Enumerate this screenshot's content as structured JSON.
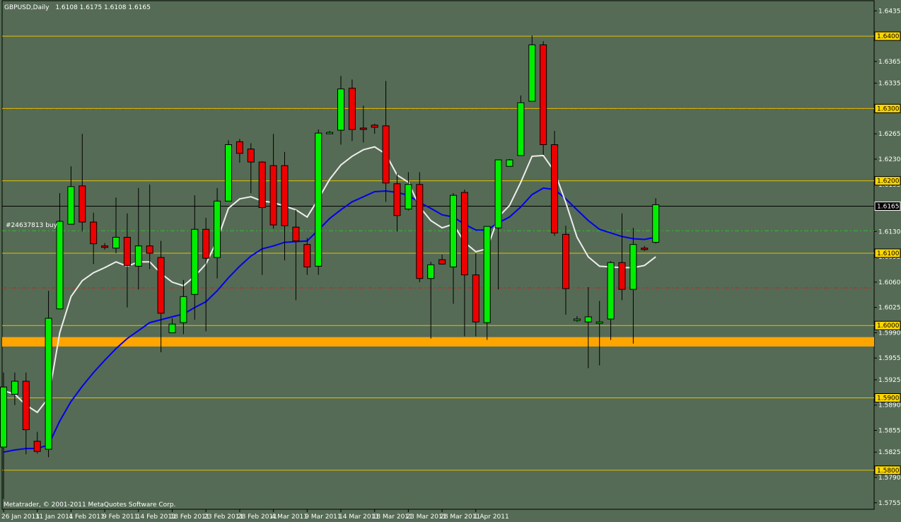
{
  "header": {
    "symbol": "GBPUSD,Daily",
    "ohlc": "1.6108 1.6175 1.6108 1.6165"
  },
  "order_label": "#24637813 buy",
  "copyright": "Metatrader, © 2001-2011 MetaQuotes Software Corp.",
  "current_price": "1.6165",
  "colors": {
    "background": "#556B55",
    "bull": "#00EE00",
    "bear": "#EE0000",
    "ma_fast": "#EEEEEE",
    "ma_slow": "#0000EE",
    "level_line": "#E0C000",
    "zone": "#FFA500",
    "red_dash": "#CC2020",
    "green_dash": "#33BB33"
  },
  "chart_data": {
    "type": "candlestick",
    "ylim": [
      1.5746,
      1.6449
    ],
    "y_ticks": [
      "1.6435",
      "1.6400",
      "1.6365",
      "1.6335",
      "1.6300",
      "1.6265",
      "1.6230",
      "1.6195",
      "1.6165",
      "1.6130",
      "1.6100",
      "1.6095",
      "1.6060",
      "1.6025",
      "1.6000",
      "1.5990",
      "1.5955",
      "1.5925",
      "1.5900",
      "1.5890",
      "1.5855",
      "1.5825",
      "1.5800",
      "1.5790",
      "1.5755"
    ],
    "x_labels": [
      "26 Jan 2011",
      "31 Jan 2011",
      "4 Feb 2011",
      "9 Feb 2011",
      "14 Feb 2011",
      "18 Feb 2011",
      "23 Feb 2011",
      "28 Feb 2011",
      "4 Mar 2011",
      "9 Mar 2011",
      "14 Mar 2011",
      "18 Mar 2011",
      "23 Mar 2011",
      "28 Mar 2011",
      "1 Apr 2011"
    ],
    "horizontal_levels": [
      {
        "price": 1.64,
        "label": "1.6400"
      },
      {
        "price": 1.63,
        "label": "1.6300"
      },
      {
        "price": 1.62,
        "label": "1.6200"
      },
      {
        "price": 1.61,
        "label": "1.6100"
      },
      {
        "price": 1.6,
        "label": "1.6000"
      },
      {
        "price": 1.59,
        "label": "1.5900"
      },
      {
        "price": 1.58,
        "label": "1.5800"
      }
    ],
    "zone": {
      "from": 1.5971,
      "to": 1.5984
    },
    "red_dashed_levels": [
      1.6299,
      1.6052
    ],
    "green_dashed_level": 1.6131,
    "candles": [
      {
        "o": 1.5832,
        "h": 1.5935,
        "l": 1.576,
        "c": 1.5915
      },
      {
        "o": 1.5905,
        "h": 1.5935,
        "l": 1.589,
        "c": 1.5923
      },
      {
        "o": 1.5923,
        "h": 1.5935,
        "l": 1.5822,
        "c": 1.5856
      },
      {
        "o": 1.584,
        "h": 1.5853,
        "l": 1.5823,
        "c": 1.5826
      },
      {
        "o": 1.5829,
        "h": 1.6048,
        "l": 1.5818,
        "c": 1.601
      },
      {
        "o": 1.6023,
        "h": 1.6183,
        "l": 1.6023,
        "c": 1.6144
      },
      {
        "o": 1.614,
        "h": 1.622,
        "l": 1.614,
        "c": 1.6192
      },
      {
        "o": 1.6193,
        "h": 1.6265,
        "l": 1.613,
        "c": 1.6143
      },
      {
        "o": 1.6143,
        "h": 1.6156,
        "l": 1.6085,
        "c": 1.6113
      },
      {
        "o": 1.611,
        "h": 1.6114,
        "l": 1.6105,
        "c": 1.6108
      },
      {
        "o": 1.6107,
        "h": 1.6177,
        "l": 1.61,
        "c": 1.6122
      },
      {
        "o": 1.6122,
        "h": 1.6155,
        "l": 1.6025,
        "c": 1.6083
      },
      {
        "o": 1.6082,
        "h": 1.619,
        "l": 1.605,
        "c": 1.611
      },
      {
        "o": 1.611,
        "h": 1.6195,
        "l": 1.6078,
        "c": 1.61
      },
      {
        "o": 1.6094,
        "h": 1.6117,
        "l": 1.5963,
        "c": 1.6017
      },
      {
        "o": 1.599,
        "h": 1.601,
        "l": 1.599,
        "c": 1.6002
      },
      {
        "o": 1.6004,
        "h": 1.6063,
        "l": 1.5988,
        "c": 1.604
      },
      {
        "o": 1.6043,
        "h": 1.618,
        "l": 1.6008,
        "c": 1.6133
      },
      {
        "o": 1.6133,
        "h": 1.6149,
        "l": 1.5992,
        "c": 1.6093
      },
      {
        "o": 1.6094,
        "h": 1.619,
        "l": 1.6065,
        "c": 1.6172
      },
      {
        "o": 1.6172,
        "h": 1.6256,
        "l": 1.6172,
        "c": 1.625
      },
      {
        "o": 1.6254,
        "h": 1.6258,
        "l": 1.6225,
        "c": 1.6238
      },
      {
        "o": 1.6244,
        "h": 1.6252,
        "l": 1.6183,
        "c": 1.6226
      },
      {
        "o": 1.6226,
        "h": 1.6227,
        "l": 1.607,
        "c": 1.6163
      },
      {
        "o": 1.6221,
        "h": 1.6265,
        "l": 1.6134,
        "c": 1.6139
      },
      {
        "o": 1.6221,
        "h": 1.624,
        "l": 1.609,
        "c": 1.6138
      },
      {
        "o": 1.6136,
        "h": 1.616,
        "l": 1.6035,
        "c": 1.6117
      },
      {
        "o": 1.6112,
        "h": 1.6121,
        "l": 1.607,
        "c": 1.6081
      },
      {
        "o": 1.6082,
        "h": 1.6271,
        "l": 1.607,
        "c": 1.6266
      },
      {
        "o": 1.6266,
        "h": 1.6269,
        "l": 1.6266,
        "c": 1.6267
      },
      {
        "o": 1.627,
        "h": 1.6345,
        "l": 1.625,
        "c": 1.6327
      },
      {
        "o": 1.6328,
        "h": 1.634,
        "l": 1.6255,
        "c": 1.6271
      },
      {
        "o": 1.6273,
        "h": 1.6304,
        "l": 1.6253,
        "c": 1.6271
      },
      {
        "o": 1.6277,
        "h": 1.6279,
        "l": 1.6265,
        "c": 1.6274
      },
      {
        "o": 1.6276,
        "h": 1.6338,
        "l": 1.6171,
        "c": 1.6197
      },
      {
        "o": 1.6196,
        "h": 1.621,
        "l": 1.613,
        "c": 1.6152
      },
      {
        "o": 1.6161,
        "h": 1.6212,
        "l": 1.6159,
        "c": 1.6195
      },
      {
        "o": 1.6195,
        "h": 1.6212,
        "l": 1.606,
        "c": 1.6065
      },
      {
        "o": 1.6065,
        "h": 1.6088,
        "l": 1.5982,
        "c": 1.6084
      },
      {
        "o": 1.6091,
        "h": 1.6098,
        "l": 1.6084,
        "c": 1.6085
      },
      {
        "o": 1.6081,
        "h": 1.6183,
        "l": 1.603,
        "c": 1.618
      },
      {
        "o": 1.6184,
        "h": 1.6188,
        "l": 1.5985,
        "c": 1.607
      },
      {
        "o": 1.607,
        "h": 1.61,
        "l": 1.5985,
        "c": 1.6005
      },
      {
        "o": 1.6004,
        "h": 1.6137,
        "l": 1.598,
        "c": 1.6137
      },
      {
        "o": 1.6135,
        "h": 1.6229,
        "l": 1.605,
        "c": 1.6229
      },
      {
        "o": 1.622,
        "h": 1.623,
        "l": 1.622,
        "c": 1.6229
      },
      {
        "o": 1.6235,
        "h": 1.6318,
        "l": 1.6235,
        "c": 1.6308
      },
      {
        "o": 1.631,
        "h": 1.6401,
        "l": 1.631,
        "c": 1.6388
      },
      {
        "o": 1.6388,
        "h": 1.6393,
        "l": 1.6236,
        "c": 1.625
      },
      {
        "o": 1.625,
        "h": 1.6269,
        "l": 1.6124,
        "c": 1.6128
      },
      {
        "o": 1.6126,
        "h": 1.6138,
        "l": 1.6015,
        "c": 1.6051
      },
      {
        "o": 1.6008,
        "h": 1.6013,
        "l": 1.6005,
        "c": 1.6009
      },
      {
        "o": 1.6005,
        "h": 1.6053,
        "l": 1.5941,
        "c": 1.6012
      },
      {
        "o": 1.6004,
        "h": 1.6034,
        "l": 1.5945,
        "c": 1.6005
      },
      {
        "o": 1.6009,
        "h": 1.6089,
        "l": 1.598,
        "c": 1.6087
      },
      {
        "o": 1.6087,
        "h": 1.6155,
        "l": 1.6035,
        "c": 1.605
      },
      {
        "o": 1.605,
        "h": 1.6135,
        "l": 1.5975,
        "c": 1.6112
      },
      {
        "o": 1.6107,
        "h": 1.611,
        "l": 1.6103,
        "c": 1.6105
      },
      {
        "o": 1.6115,
        "h": 1.6176,
        "l": 1.6113,
        "c": 1.6167
      }
    ],
    "ma_fast": [
      1.591,
      1.5905,
      1.589,
      1.588,
      1.59,
      1.599,
      1.604,
      1.6062,
      1.6073,
      1.608,
      1.6088,
      1.6082,
      1.6088,
      1.6088,
      1.6072,
      1.606,
      1.6055,
      1.6068,
      1.6085,
      1.6118,
      1.6162,
      1.6175,
      1.6178,
      1.6172,
      1.617,
      1.6165,
      1.616,
      1.615,
      1.6175,
      1.6202,
      1.6222,
      1.6234,
      1.6243,
      1.6247,
      1.6237,
      1.6208,
      1.6198,
      1.6164,
      1.6145,
      1.6135,
      1.614,
      1.6115,
      1.6102,
      1.6106,
      1.615,
      1.6166,
      1.6198,
      1.6234,
      1.6235,
      1.6213,
      1.617,
      1.6122,
      1.6095,
      1.6082,
      1.6081,
      1.608,
      1.608,
      1.6083,
      1.6095
    ],
    "ma_slow": [
      1.5825,
      1.5828,
      1.583,
      1.583,
      1.5835,
      1.5868,
      1.5895,
      1.5916,
      1.5935,
      1.5952,
      1.5968,
      1.5982,
      1.5993,
      1.6004,
      1.6008,
      1.6012,
      1.6016,
      1.6025,
      1.6033,
      1.6048,
      1.6066,
      1.6082,
      1.6096,
      1.6106,
      1.611,
      1.6115,
      1.6116,
      1.6117,
      1.6132,
      1.6148,
      1.616,
      1.6171,
      1.6178,
      1.6185,
      1.6186,
      1.6184,
      1.618,
      1.617,
      1.6162,
      1.6153,
      1.615,
      1.614,
      1.6132,
      1.6132,
      1.6142,
      1.615,
      1.6164,
      1.6181,
      1.619,
      1.6188,
      1.6175,
      1.616,
      1.6145,
      1.6133,
      1.6128,
      1.6123,
      1.612,
      1.6119,
      1.6122
    ]
  }
}
